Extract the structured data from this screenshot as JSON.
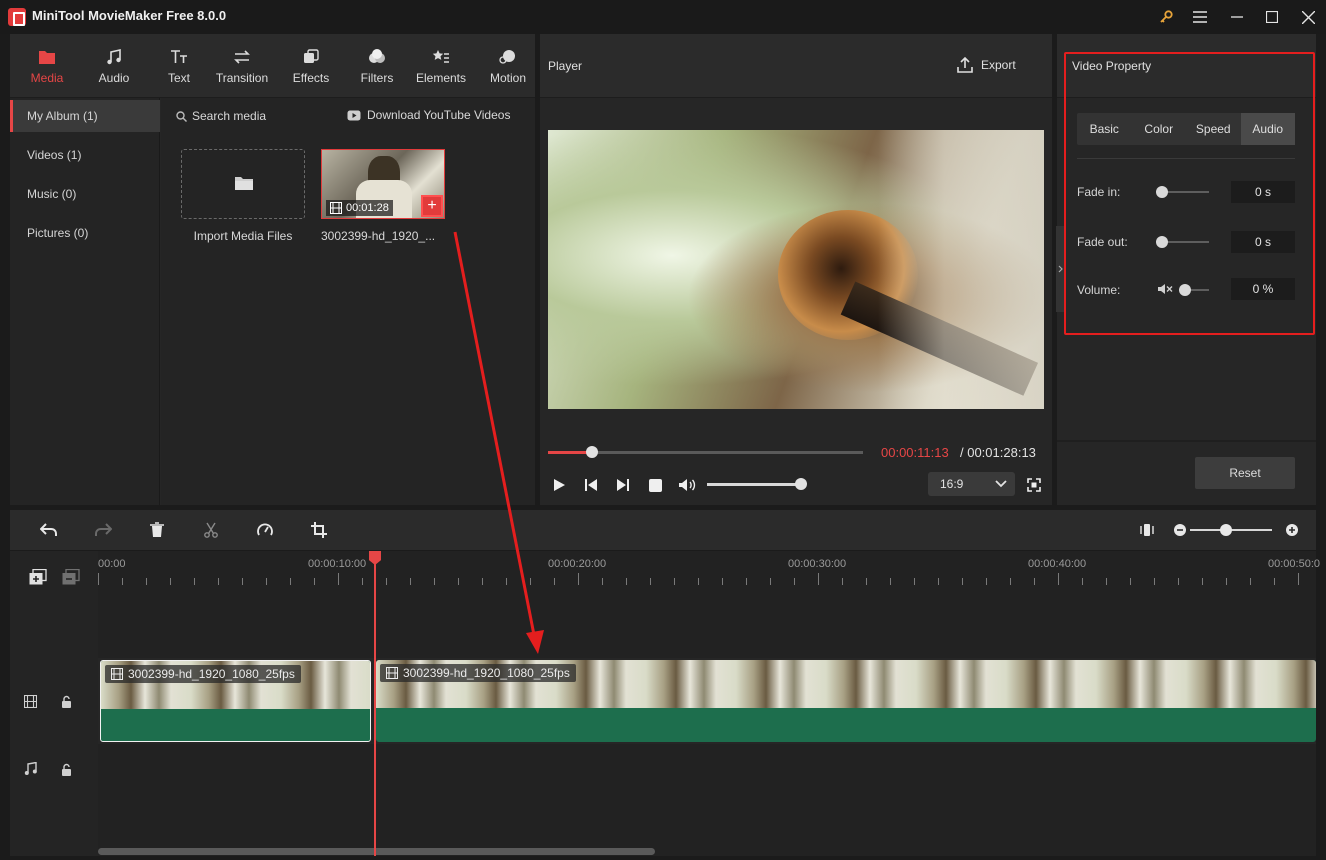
{
  "app": {
    "title": "MiniTool MovieMaker Free 8.0.0"
  },
  "media_tabs": [
    {
      "label": "Media",
      "icon": "folder-icon"
    },
    {
      "label": "Audio",
      "icon": "music-note-icon"
    },
    {
      "label": "Text",
      "icon": "text-icon"
    },
    {
      "label": "Transition",
      "icon": "transition-icon"
    },
    {
      "label": "Effects",
      "icon": "effects-icon"
    },
    {
      "label": "Filters",
      "icon": "filters-icon"
    },
    {
      "label": "Elements",
      "icon": "elements-icon"
    },
    {
      "label": "Motion",
      "icon": "motion-icon"
    }
  ],
  "album": [
    {
      "label": "My Album (1)"
    },
    {
      "label": "Videos (1)"
    },
    {
      "label": "Music (0)"
    },
    {
      "label": "Pictures (0)"
    }
  ],
  "media": {
    "search_label": "Search media",
    "download_label": "Download YouTube Videos",
    "import_label": "Import Media Files",
    "item_name": "3002399-hd_1920_...",
    "item_duration": "00:01:28",
    "add_label": "+"
  },
  "player": {
    "title": "Player",
    "export_label": "Export",
    "current_time": "00:00:11:13",
    "total_time": " / 00:01:28:13",
    "progress": 0.14,
    "volume": 1.0,
    "aspect_ratio": "16:9"
  },
  "property": {
    "title": "Video Property",
    "tabs": [
      "Basic",
      "Color",
      "Speed",
      "Audio"
    ],
    "active_tab": "Audio",
    "fade_in_label": "Fade in:",
    "fade_in_value": "0 s",
    "fade_out_label": "Fade out:",
    "fade_out_value": "0 s",
    "volume_label": "Volume:",
    "volume_value": "0 %",
    "reset_label": "Reset"
  },
  "timeline": {
    "ticks": [
      "00:00",
      "00:00:10:00",
      "00:00:20:00",
      "00:00:30:00",
      "00:00:40:00",
      "00:00:50:0"
    ],
    "clips": [
      {
        "label": "3002399-hd_1920_1080_25fps"
      },
      {
        "label": "3002399-hd_1920_1080_25fps"
      }
    ]
  },
  "colors": {
    "accent": "#e64646",
    "highlight": "#e41e1e",
    "clip_green": "#1d6e4d",
    "panel": "#262626"
  }
}
